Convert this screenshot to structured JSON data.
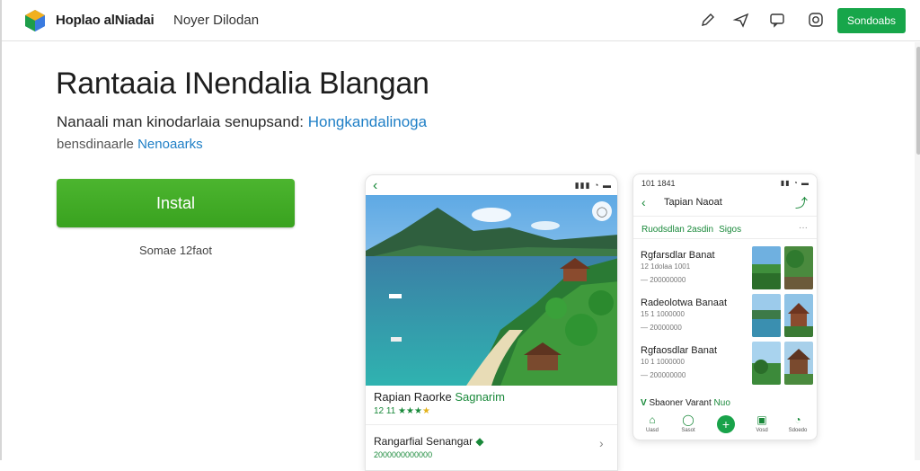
{
  "header": {
    "brand": "Hoplao alNiadai",
    "nav_link": "Noyer Dilodan",
    "icons": [
      "edit-icon",
      "send-icon",
      "chat-icon",
      "instagram-icon"
    ],
    "signin_label": "Sondoabs"
  },
  "hero": {
    "title": "Rantaaia INendalia Blangan",
    "desc_line1_prefix": "Nanaali man kinodarlaia senupsand: ",
    "desc_line1_link": "Hongkandalinoga",
    "desc_line2_prefix": "bensdinaarle ",
    "desc_line2_link": "Nenoaarks",
    "install_label": "Instal",
    "install_note": "Somae 12faot"
  },
  "phone1": {
    "back": "‹",
    "signal": "▮▮▮ ◔ ▬",
    "fab": "◯",
    "place_name": "Rapian Raorke ",
    "place_tag": "Sagnarim",
    "rating_text": "12 11 ★★★",
    "rating_star": "★",
    "row2_name": "Rangarfial Senangar ",
    "row2_dot": "◆",
    "row2_sub": "2000000000000",
    "row2_chevron": "›"
  },
  "phone2": {
    "time": "101 1841",
    "signal": "▮▮ ◔ ▬",
    "back": "‹",
    "title": "Tapian Naoat",
    "share": "⤴",
    "filter_label": "Ruodsdlan 2asdin",
    "filter_sub": "Sigos",
    "more": "···",
    "items": [
      {
        "name": "Rgfarsdlar Banat",
        "meta": "12 1dolaa 1001",
        "meta2": "—  200000000"
      },
      {
        "name": "Radeolotwa Banaat",
        "meta": "15 1   1000000",
        "meta2": "—  20000000"
      },
      {
        "name": "Rgfaosdlar Banat",
        "meta": "10 1  1000000",
        "meta2": "—  200000000"
      }
    ],
    "category_prefix": "V  ",
    "category": "Sbaoner Varant ",
    "category_tag": "Nuo",
    "tabs": [
      {
        "icon": "⌂",
        "label": "Uasd"
      },
      {
        "icon": "◯",
        "label": "Sasot"
      },
      {
        "icon": "▣",
        "label": "Vosd"
      },
      {
        "icon": "◔",
        "label": "Sdoedo"
      }
    ],
    "fab": "+"
  },
  "colors": {
    "accent": "#17a64a",
    "install": "#3ea526",
    "link": "#1f7fc6"
  }
}
